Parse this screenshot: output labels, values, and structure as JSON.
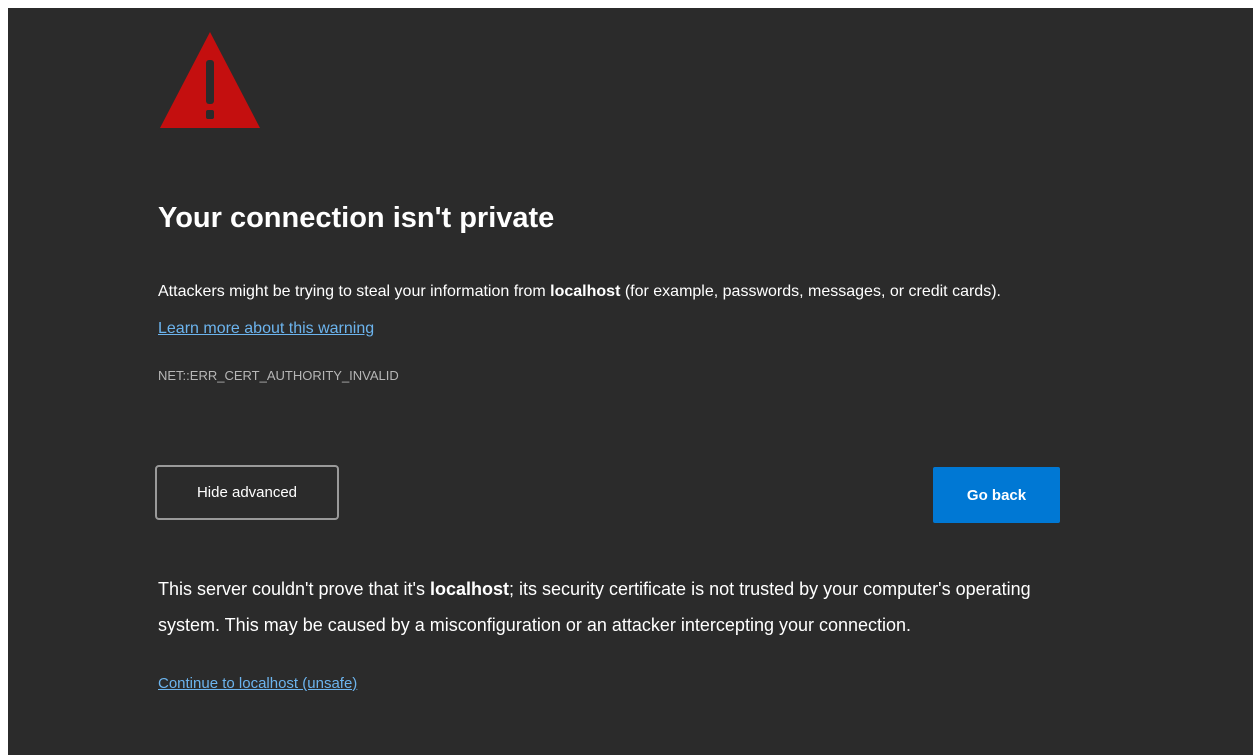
{
  "warning_icon": "warning-triangle-icon",
  "title": "Your connection isn't private",
  "intro": {
    "before": "Attackers might be trying to steal your information from ",
    "host": "localhost",
    "after": " (for example, passwords, messages, or credit cards). ",
    "link": "Learn more about this warning"
  },
  "error_code": "NET::ERR_CERT_AUTHORITY_INVALID",
  "buttons": {
    "hide_advanced": "Hide advanced",
    "go_back": "Go back"
  },
  "details": {
    "before": "This server couldn't prove that it's ",
    "host": "localhost",
    "after": "; its security certificate is not trusted by your computer's operating system. This may be caused by a misconfiguration or an attacker intercepting your connection."
  },
  "proceed_link": "Continue to localhost (unsafe)",
  "colors": {
    "background": "#2b2b2b",
    "warning": "#c40f0f",
    "primary_button": "#0078d4",
    "link": "#6cb4ee",
    "muted_text": "#b6b6b6"
  }
}
